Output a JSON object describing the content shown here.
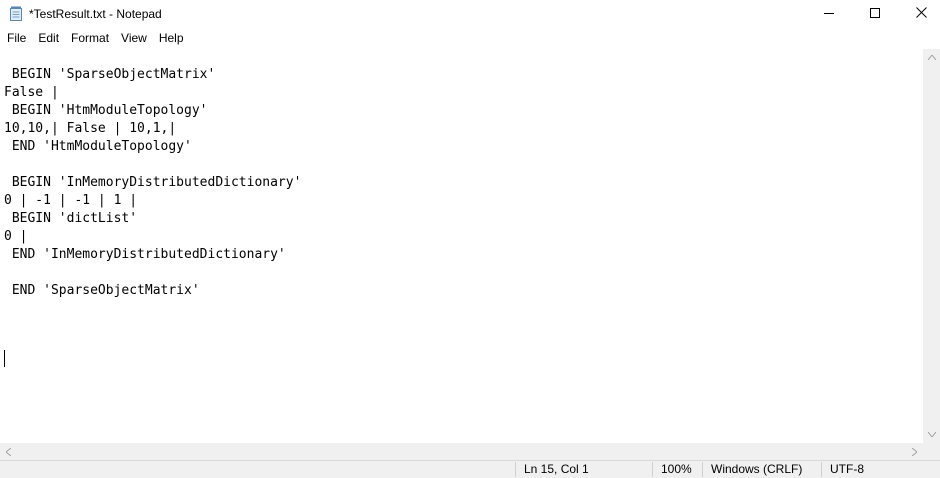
{
  "window": {
    "title": "*TestResult.txt - Notepad",
    "app_icon": "notepad-icon",
    "controls": {
      "minimize_icon": "minimize-icon",
      "maximize_icon": "maximize-icon",
      "close_icon": "close-icon"
    }
  },
  "menu": {
    "items": [
      "File",
      "Edit",
      "Format",
      "View",
      "Help"
    ]
  },
  "editor": {
    "content": " BEGIN 'SparseObjectMatrix'\nFalse |\n BEGIN 'HtmModuleTopology'\n10,10,| False | 10,1,|\n END 'HtmModuleTopology'\n\n BEGIN 'InMemoryDistributedDictionary'\n0 | -1 | -1 | 1 |\n BEGIN 'dictList'\n0 |\n END 'InMemoryDistributedDictionary'\n\n END 'SparseObjectMatrix'\n"
  },
  "statusbar": {
    "position": "Ln 15, Col 1",
    "zoom": "100%",
    "line_ending": "Windows (CRLF)",
    "encoding": "UTF-8"
  },
  "colors": {
    "background": "#ffffff",
    "chrome": "#f0f0f0",
    "text": "#000000"
  }
}
